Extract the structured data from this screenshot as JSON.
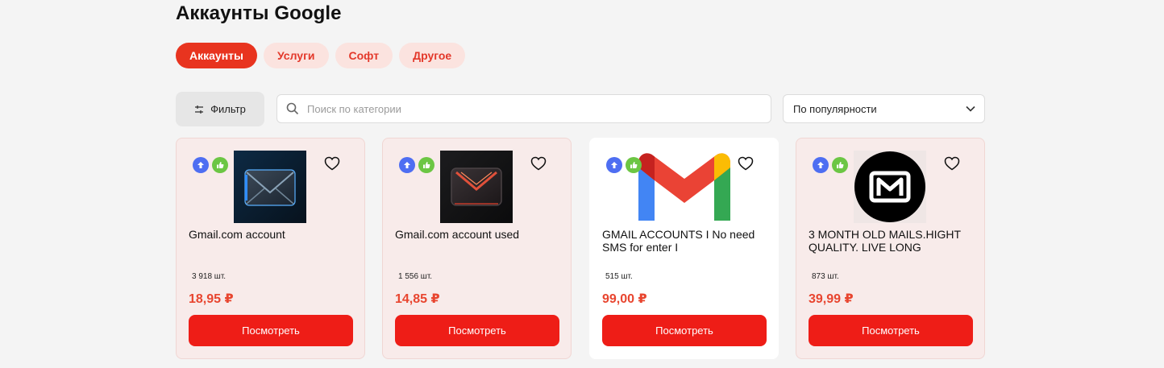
{
  "page": {
    "title": "Аккаунты Google"
  },
  "tabs": [
    {
      "label": "Аккаунты",
      "active": true
    },
    {
      "label": "Услуги",
      "active": false
    },
    {
      "label": "Софт",
      "active": false
    },
    {
      "label": "Другое",
      "active": false
    }
  ],
  "toolbar": {
    "filter_label": "Фильтр",
    "search_placeholder": "Поиск по категории",
    "sort_value": "По популярности"
  },
  "colors": {
    "accent": "#ee1d17",
    "price": "#e8452f",
    "badge_blue": "#4e6ef2",
    "badge_green": "#6cc644"
  },
  "products": [
    {
      "title": "Gmail.com account",
      "stock": "3 918 шт.",
      "price": "18,95 ₽",
      "button": "Посмотреть",
      "image": "dark-envelope-blue"
    },
    {
      "title": "Gmail.com account used",
      "stock": "1 556 шт.",
      "price": "14,85 ₽",
      "button": "Посмотреть",
      "image": "dark-envelope-red"
    },
    {
      "title": "GMAIL ACCOUNTS I No need SMS  for enter I",
      "stock": "515 шт.",
      "price": "99,00 ₽",
      "button": "Посмотреть",
      "image": "gmail-logo"
    },
    {
      "title": "3 MONTH OLD MAILS.HIGHT QUALITY. LIVE LONG",
      "stock": "873 шт.",
      "price": "39,99 ₽",
      "button": "Посмотреть",
      "image": "black-circle-m-logo"
    }
  ]
}
